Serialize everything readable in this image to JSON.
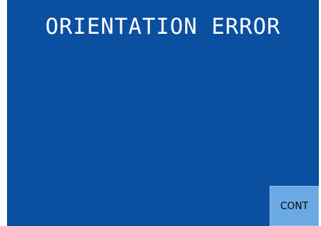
{
  "screen": {
    "title": "ORIENTATION ERROR",
    "background_color": "#0b4fa1"
  },
  "actions": {
    "cont_label": "CONT",
    "button_color": "#6aa9e3"
  }
}
